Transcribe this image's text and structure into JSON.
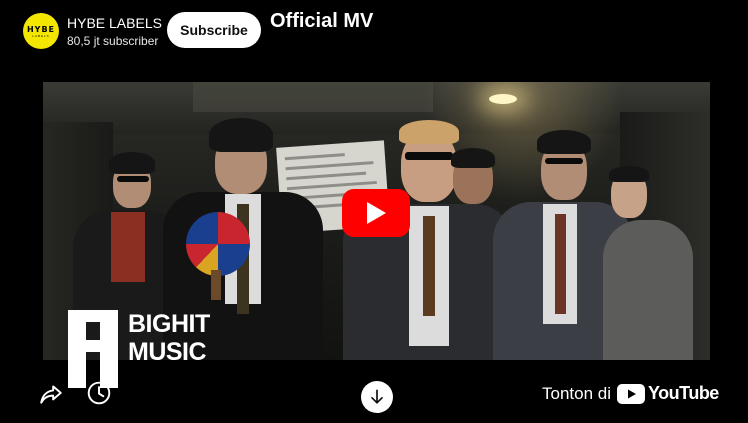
{
  "channel": {
    "name": "HYBE LABELS",
    "avatar_text": "HYBE",
    "avatar_subtext": "LABELS",
    "subscribers": "80,5 jt subscriber",
    "subscribe_label": "Subscribe"
  },
  "video": {
    "title": "Official MV"
  },
  "watermark": {
    "line1": "BIGHIT",
    "line2": "MUSIC"
  },
  "controls": {
    "share_icon": "share-icon",
    "watch_later_icon": "clock-icon",
    "download_icon": "arrow-down-icon",
    "watch_on_label": "Tonton di",
    "youtube_word": "YouTube"
  },
  "colors": {
    "background": "#000000",
    "play_red": "#ff0000",
    "avatar_yellow": "#f3e600",
    "subscribe_bg": "#ffffff"
  }
}
